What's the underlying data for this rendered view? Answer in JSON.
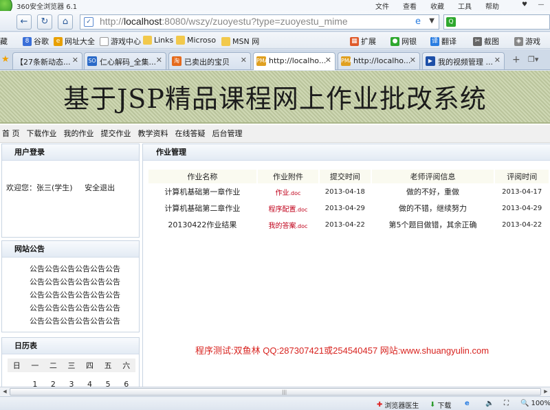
{
  "browser": {
    "window_title": "360安全浏览器 6.1",
    "menus": [
      "文件",
      "查看",
      "收藏",
      "工具",
      "帮助"
    ],
    "url_host": "localhost",
    "url_prefix": "http://",
    "url_rest": ":8080/wszy/zuoyestu?type=zuoyestu_mime",
    "bookmarks": [
      "藏",
      "谷歌",
      "网址大全",
      "游戏中心",
      "Links",
      "Microso",
      "MSN 网",
      "扩展",
      "网银",
      "翻译",
      "截图",
      "游戏"
    ],
    "tabs": [
      "【27条新动态...",
      "仁心解码_全集...",
      "已卖出的宝贝",
      "http://localho...",
      "http://localho...",
      "我的视频管理 ..."
    ],
    "status": {
      "doctor": "浏览器医生",
      "download": "下载",
      "zoom": "100%"
    }
  },
  "site": {
    "banner_title": "基于JSP精品课程网上作业批改系统",
    "nav": [
      "首 页",
      "下载作业",
      "我的作业",
      "提交作业",
      "教学资料",
      "在线答疑",
      "后台管理"
    ]
  },
  "login": {
    "title": "用户登录",
    "welcome": "欢迎您：张三(学生)",
    "logout": "安全退出"
  },
  "notice": {
    "title": "网站公告",
    "lines": [
      "公告公告公告公告公告公告",
      "公告公告公告公告公告公告",
      "公告公告公告公告公告公告",
      "公告公告公告公告公告公告",
      "公告公告公告公告公告公告"
    ]
  },
  "calendar": {
    "title": "日历表",
    "weekdays": [
      "日",
      "一",
      "二",
      "三",
      "四",
      "五",
      "六"
    ],
    "first_row": [
      "",
      "1",
      "2",
      "3",
      "4",
      "5",
      "6"
    ]
  },
  "homework": {
    "title": "作业管理",
    "columns": [
      "作业名称",
      "作业附件",
      "提交时间",
      "老师评阅信息",
      "评阅时间"
    ],
    "rows": [
      {
        "name": "计算机基础第一章作业",
        "att_name": "作业",
        "att_ext": ".doc",
        "submit": "2013-04-18",
        "comment": "做的不好，重做",
        "review": "2013-04-17"
      },
      {
        "name": "计算机基础第二章作业",
        "att_name": "程序配置",
        "att_ext": ".doc",
        "submit": "2013-04-29",
        "comment": "做的不错，继续努力",
        "review": "2013-04-29"
      },
      {
        "name": "20130422作业结果",
        "att_name": "我的答案",
        "att_ext": ".doc",
        "submit": "2013-04-22",
        "comment": "第5个题目做错，其余正确",
        "review": "2013-04-22"
      }
    ]
  },
  "credit": "程序测试:双鱼林 QQ:287307421或254540457 网站:www.shuangyulin.com"
}
